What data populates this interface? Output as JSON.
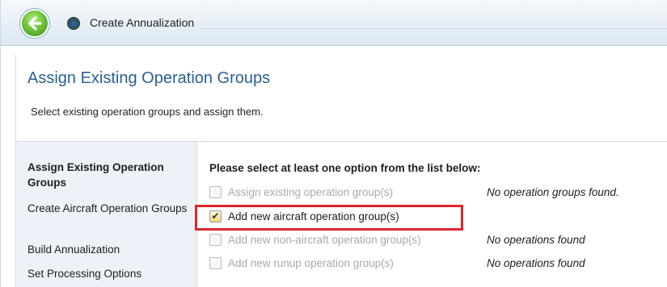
{
  "window": {
    "title": "Create Annualization",
    "back_icon": "back-arrow-icon",
    "app_icon": "globe-icon"
  },
  "header": {
    "title": "Assign Existing Operation Groups",
    "subtitle": "Select existing operation groups and assign them."
  },
  "sidebar": {
    "steps": [
      {
        "label": "Assign Existing Operation Groups",
        "active": true
      },
      {
        "label": "Create Aircraft Operation Groups",
        "active": false
      },
      {
        "label": "Build Annualization",
        "active": false
      },
      {
        "label": "Set Processing Options",
        "active": false
      }
    ]
  },
  "main": {
    "prompt": "Please select at least one option from the list below:",
    "options": [
      {
        "label": "Assign existing operation group(s)",
        "checked": false,
        "enabled": false,
        "note": "No operation groups found."
      },
      {
        "label": "Add new aircraft operation group(s)",
        "checked": true,
        "enabled": true,
        "note": ""
      },
      {
        "label": "Add new non-aircraft operation group(s)",
        "checked": false,
        "enabled": false,
        "note": "No operations found"
      },
      {
        "label": "Add new runup operation group(s)",
        "checked": false,
        "enabled": false,
        "note": "No operations found"
      }
    ]
  },
  "colors": {
    "title_blue": "#2c5e95",
    "sidebar_bg": "#edf2f8",
    "highlight_red": "#e0242b",
    "disabled_text": "#a5a9b0"
  }
}
